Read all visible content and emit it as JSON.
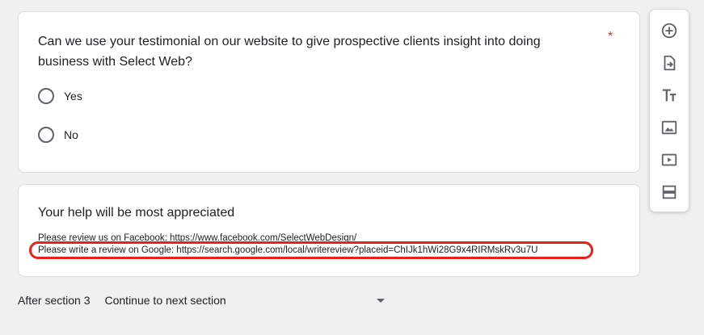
{
  "question": {
    "title": "Can we use your testimonial on our website to give prospective clients insight into doing business with Select Web?",
    "required_mark": "*",
    "options": [
      "Yes",
      "No"
    ]
  },
  "section": {
    "title": "Your help will be most appreciated",
    "lines": [
      "Please review us on Facebook: https://www.facebook.com/SelectWebDesign/",
      "Please write a review on Google: https://search.google.com/local/writereview?placeid=ChIJk1hWi28G9x4RIRMskRv3u7U"
    ]
  },
  "after_section": {
    "label": "After section 3",
    "value": "Continue to next section"
  },
  "toolbar": {
    "icons": [
      "add-question-icon",
      "import-questions-icon",
      "add-title-icon",
      "add-image-icon",
      "add-video-icon",
      "add-section-icon"
    ]
  },
  "colors": {
    "required": "#d93025",
    "highlight": "#e8211c",
    "icon": "#5f6368"
  }
}
